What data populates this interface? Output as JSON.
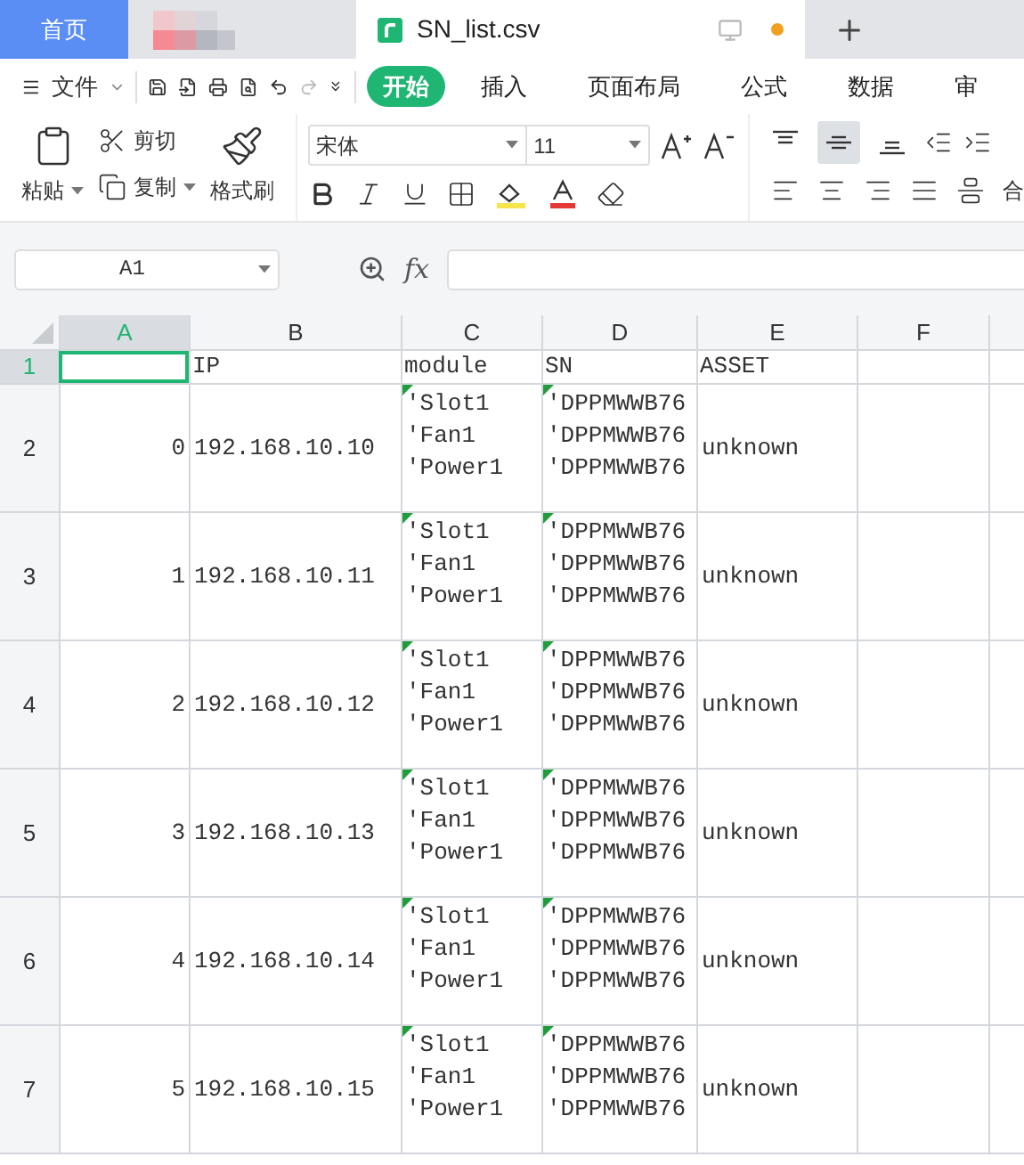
{
  "tabs": [
    {
      "kind": "home",
      "label": "首页",
      "selected": false
    },
    {
      "kind": "blurred",
      "selected": false
    },
    {
      "kind": "file",
      "label": "SN_list.csv",
      "selected": true,
      "unsaved": true
    }
  ],
  "menu": {
    "file_label": "文件",
    "ribbon_tabs": [
      {
        "label": "开始",
        "selected": true
      },
      {
        "label": "插入",
        "selected": false
      },
      {
        "label": "页面布局",
        "selected": false
      },
      {
        "label": "公式",
        "selected": false
      },
      {
        "label": "数据",
        "selected": false
      },
      {
        "label": "审",
        "selected": false
      }
    ]
  },
  "ribbon": {
    "paste": "粘贴",
    "cut": "剪切",
    "copy": "复制",
    "format_painter": "格式刷",
    "font": "宋体",
    "font_size": "11",
    "valign": [
      {
        "kind": "top",
        "selected": false
      },
      {
        "kind": "middle",
        "selected": true
      },
      {
        "kind": "bottom",
        "selected": false
      }
    ],
    "merge": "合"
  },
  "formula_bar": {
    "name_box": "A1",
    "fx": "fx"
  },
  "sheet": {
    "columns": [
      {
        "label": "A",
        "selected": true
      },
      {
        "label": "B",
        "selected": false
      },
      {
        "label": "C",
        "selected": false
      },
      {
        "label": "D",
        "selected": false
      },
      {
        "label": "E",
        "selected": false
      },
      {
        "label": "F",
        "selected": false
      }
    ],
    "header_row": {
      "number": "1",
      "selected": true,
      "cells": [
        "",
        "IP",
        "module",
        "SN",
        "ASSET"
      ]
    },
    "rows": [
      {
        "number": "2",
        "index": "0",
        "ip": "192.168.10.10",
        "module": [
          "'Slot1",
          "'Fan1",
          "'Power1"
        ],
        "sn": [
          "'DPPMWWB76",
          "'DPPMWWB76",
          "'DPPMWWB76"
        ],
        "asset": "unknown",
        "flagged": true
      },
      {
        "number": "3",
        "index": "1",
        "ip": "192.168.10.11",
        "module": [
          "'Slot1",
          "'Fan1",
          "'Power1"
        ],
        "sn": [
          "'DPPMWWB76",
          "'DPPMWWB76",
          "'DPPMWWB76"
        ],
        "asset": "unknown",
        "flagged": true
      },
      {
        "number": "4",
        "index": "2",
        "ip": "192.168.10.12",
        "module": [
          "'Slot1",
          "'Fan1",
          "'Power1"
        ],
        "sn": [
          "'DPPMWWB76",
          "'DPPMWWB76",
          "'DPPMWWB76"
        ],
        "asset": "unknown",
        "flagged": true
      },
      {
        "number": "5",
        "index": "3",
        "ip": "192.168.10.13",
        "module": [
          "'Slot1",
          "'Fan1",
          "'Power1"
        ],
        "sn": [
          "'DPPMWWB76",
          "'DPPMWWB76",
          "'DPPMWWB76"
        ],
        "asset": "unknown",
        "flagged": true
      },
      {
        "number": "6",
        "index": "4",
        "ip": "192.168.10.14",
        "module": [
          "'Slot1",
          "'Fan1",
          "'Power1"
        ],
        "sn": [
          "'DPPMWWB76",
          "'DPPMWWB76",
          "'DPPMWWB76"
        ],
        "asset": "unknown",
        "flagged": true
      },
      {
        "number": "7",
        "index": "5",
        "ip": "192.168.10.15",
        "module": [
          "'Slot1",
          "'Fan1",
          "'Power1"
        ],
        "sn": [
          "'DPPMWWB76",
          "'DPPMWWB76",
          "'DPPMWWB76"
        ],
        "asset": "unknown",
        "flagged": true
      }
    ]
  }
}
